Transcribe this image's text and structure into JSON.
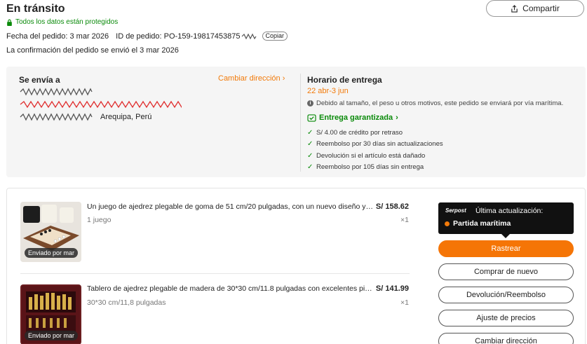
{
  "header": {
    "title": "En tránsito",
    "secure_note": "Todos los datos están protegidos",
    "share_label": "Compartir"
  },
  "order": {
    "date_label": "Fecha del pedido: 3 mar 2026",
    "id_label": "ID de pedido: PO-159-19817453875",
    "copy_label": "Copiar",
    "confirmation": "La confirmación del pedido se envió el 3 mar 2026"
  },
  "shipping": {
    "title": "Se envía a",
    "change_address": "Cambiar dirección",
    "address_visible": "Arequipa, Perú"
  },
  "delivery": {
    "title": "Horario de entrega",
    "range": "22 abr-3 jun",
    "note": "Debido al tamaño, el peso u otros motivos, este pedido se enviará por vía marítima.",
    "guarantee": "Entrega garantizada",
    "bullets": [
      "S/ 4.00 de crédito por retraso",
      "Reembolso por 30 días sin actualizaciones",
      "Devolución si el artículo está dañado",
      "Reembolso por 105 días sin entrega"
    ]
  },
  "items": [
    {
      "name": "Un juego de ajedrez plegable de goma de 51 cm/20 pulgadas, con un nuevo diseño y juego de ajedrez",
      "price": "S/ 158.62",
      "variant": "1 juego",
      "qty": "×1",
      "badge": "Enviado por mar"
    },
    {
      "name": "Tablero de ajedrez plegable de madera de 30*30 cm/11.8 pulgadas con excelentes piezas de ajedrez",
      "price": "S/ 141.99",
      "variant": "30*30 cm/11,8 pulgadas",
      "qty": "×1",
      "badge": "Enviado por mar"
    }
  ],
  "tracking": {
    "carrier": "Serpost",
    "last_update_label": "Última actualización:",
    "status": "Partida marítima"
  },
  "actions": {
    "track": "Rastrear",
    "buy_again": "Comprar de nuevo",
    "return_refund": "Devolución/Reembolso",
    "price_adjust": "Ajuste de precios",
    "change_address": "Cambiar dirección"
  },
  "colors": {
    "accent": "#f57506",
    "success": "#0a8a0a",
    "redacted_red": "#e03030"
  }
}
